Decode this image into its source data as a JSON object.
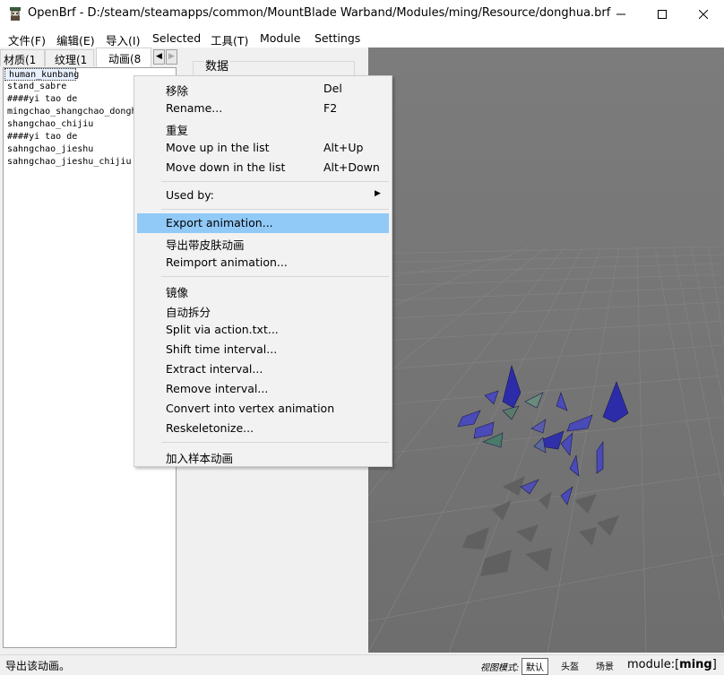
{
  "window": {
    "title": "OpenBrf - D:/steam/steamapps/common/MountBlade Warband/Modules/ming/Resource/donghua.brf",
    "minimize_icon": "minimize-icon",
    "maximize_icon": "maximize-icon",
    "close_icon": "close-icon"
  },
  "menubar": {
    "items": [
      {
        "label": "文件(F)"
      },
      {
        "label": "编辑(E)"
      },
      {
        "label": "导入(I)"
      },
      {
        "label": "Selected"
      },
      {
        "label": "工具(T)"
      },
      {
        "label": "Module"
      },
      {
        "label": "Settings"
      }
    ]
  },
  "tabs": [
    {
      "label": "材质(1"
    },
    {
      "label": "纹理(1"
    },
    {
      "label": "动画(8"
    }
  ],
  "list": {
    "items": [
      {
        "label": "human_kunbang"
      },
      {
        "label": "stand_sabre"
      },
      {
        "label": "####yi tao de"
      },
      {
        "label": "mingchao_shangchao_dongh"
      },
      {
        "label": "shangchao_chijiu"
      },
      {
        "label": "####yi tao de"
      },
      {
        "label": "sahngchao_jieshu"
      },
      {
        "label": "sahngchao_jieshu_chijiu"
      }
    ],
    "selected_index": 0
  },
  "data_panel": {
    "label": "数据"
  },
  "context_menu": {
    "items": [
      {
        "label": "移除",
        "shortcut": "Del"
      },
      {
        "label": "Rename...",
        "shortcut": "F2"
      },
      {
        "label": "重复",
        "shortcut": ""
      },
      {
        "label": "Move up in the list",
        "shortcut": "Alt+Up"
      },
      {
        "label": "Move down in the list",
        "shortcut": "Alt+Down"
      },
      {
        "label": "Used by:",
        "shortcut": ""
      },
      {
        "label": "Export animation...",
        "shortcut": ""
      },
      {
        "label": "导出带皮肤动画",
        "shortcut": ""
      },
      {
        "label": "Reimport animation...",
        "shortcut": ""
      },
      {
        "label": "镜像",
        "shortcut": ""
      },
      {
        "label": "自动拆分",
        "shortcut": ""
      },
      {
        "label": "Split via action.txt...",
        "shortcut": ""
      },
      {
        "label": "Shift time interval...",
        "shortcut": ""
      },
      {
        "label": "Extract interval...",
        "shortcut": ""
      },
      {
        "label": "Remove interval...",
        "shortcut": ""
      },
      {
        "label": "Convert into vertex animation",
        "shortcut": ""
      },
      {
        "label": "Reskeletonize...",
        "shortcut": ""
      },
      {
        "label": "加入样本动画",
        "shortcut": ""
      }
    ],
    "highlighted": "Export animation...",
    "highlight_color": "#91c9f7"
  },
  "statusbar": {
    "text": "导出该动画。",
    "view_mode_label": "视图模式:",
    "view_modes": [
      {
        "label": "默认"
      },
      {
        "label": "头盔"
      },
      {
        "label": "场景"
      }
    ],
    "active_view_mode": "默认",
    "module_prefix": "module:[",
    "module_name": "ming",
    "module_suffix": "]"
  },
  "colors": {
    "viewport_bg": "#777777",
    "grid_line": "#8a8a8a",
    "bone_blue": "#3a3ab8",
    "bone_green": "#4a8a6a",
    "shadow": "#5e5e5e"
  }
}
